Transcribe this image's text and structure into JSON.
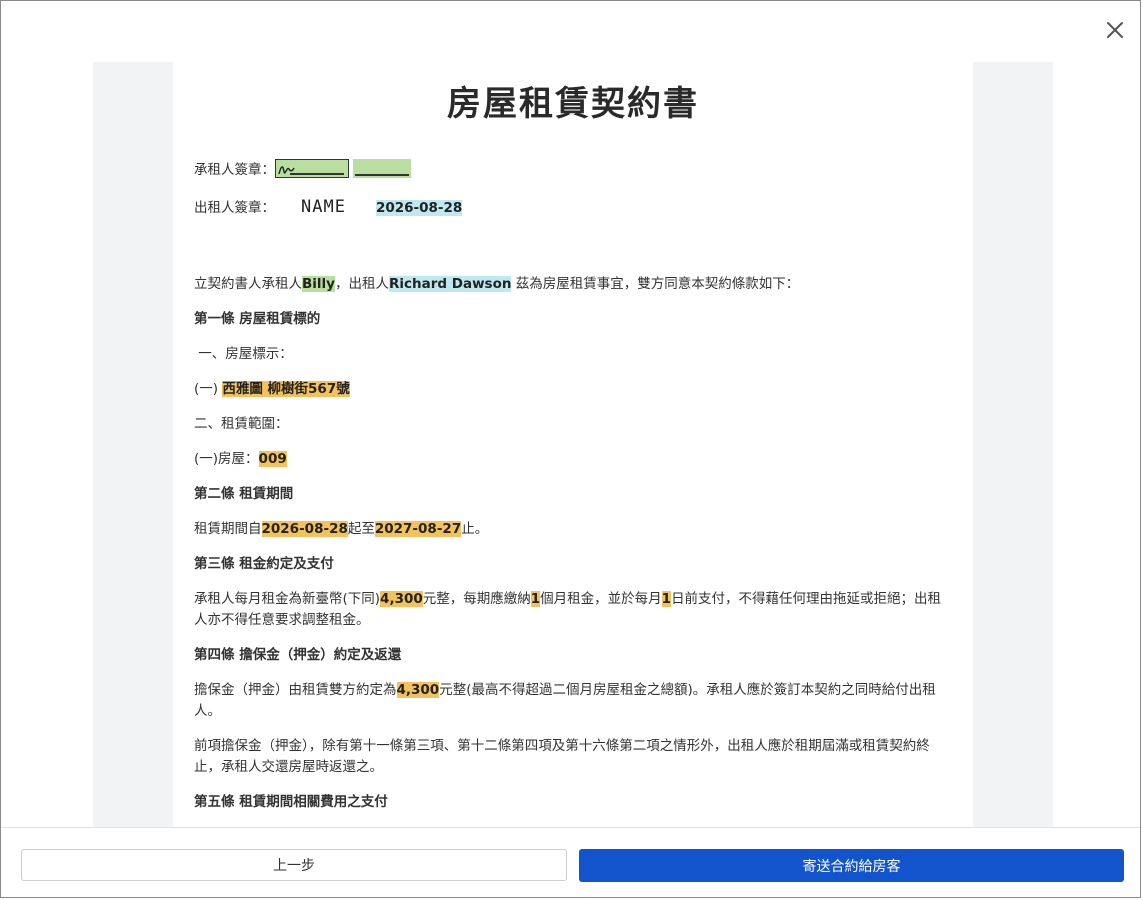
{
  "document": {
    "title": "房屋租賃契約書",
    "tenant_sign_label": "承租人簽章：",
    "landlord_sign_label": "出租人簽章：",
    "landlord_signature_text": "NAME",
    "landlord_sign_date": "2026-08-28",
    "intro": {
      "prefix": "立契約書人承租人",
      "tenant_name": "Billy",
      "mid": "，出租人",
      "landlord_name": "Richard Dawson",
      "suffix": " 茲為房屋租賃事宜，雙方同意本契約條款如下："
    },
    "art1_title": "第一條 房屋租賃標的",
    "art1_item1": " 一、房屋標示：",
    "art1_item1_sub_prefix": "(一) ",
    "art1_address": "西雅圖 柳樹街567號",
    "art1_item2": "二、租賃範圍：",
    "art1_item2_sub_prefix": "(一)房屋：",
    "art1_unit": "009",
    "art2_title": "第二條 租賃期間",
    "art2_text": {
      "prefix": "租賃期間自",
      "start": "2026-08-28",
      "mid": "起至",
      "end": "2027-08-27",
      "suffix": "止。"
    },
    "art3_title": "第三條 租金約定及支付",
    "art3_text": {
      "p1": "承租人每月租金為新臺幣(下同)",
      "rent": "4,300",
      "p2": "元整，每期應繳納",
      "months": "1",
      "p3": "個月租金，並於每月",
      "day": "1",
      "p4": "日前支付，不得藉任何理由拖延或拒絕；出租人亦不得任意要求調整租金。"
    },
    "art4_title": "第四條 擔保金（押金）約定及返還",
    "art4_text1": {
      "p1": "擔保金（押金）由租賃雙方約定為",
      "deposit": "4,300",
      "p2": "元整(最高不得超過二個月房屋租金之總額)。承租人應於簽訂本契約之同時給付出租人。"
    },
    "art4_text2": "前項擔保金（押金），除有第十一條第三項、第十二條第四項及第十六條第二項之情形外，出租人應於租期屆滿或租賃契約終止，承租人交還房屋時返還之。",
    "art5_title": "第五條 租賃期間相關費用之支付"
  },
  "footer": {
    "prev_label": "上一步",
    "send_label": "寄送合約給房客"
  },
  "icons": {
    "close": "close-icon"
  },
  "colors": {
    "primary": "#1254cc",
    "tenant_highlight": "#b8dfa0",
    "landlord_highlight": "#bfe8f0",
    "field_highlight": "#f4c25c"
  }
}
